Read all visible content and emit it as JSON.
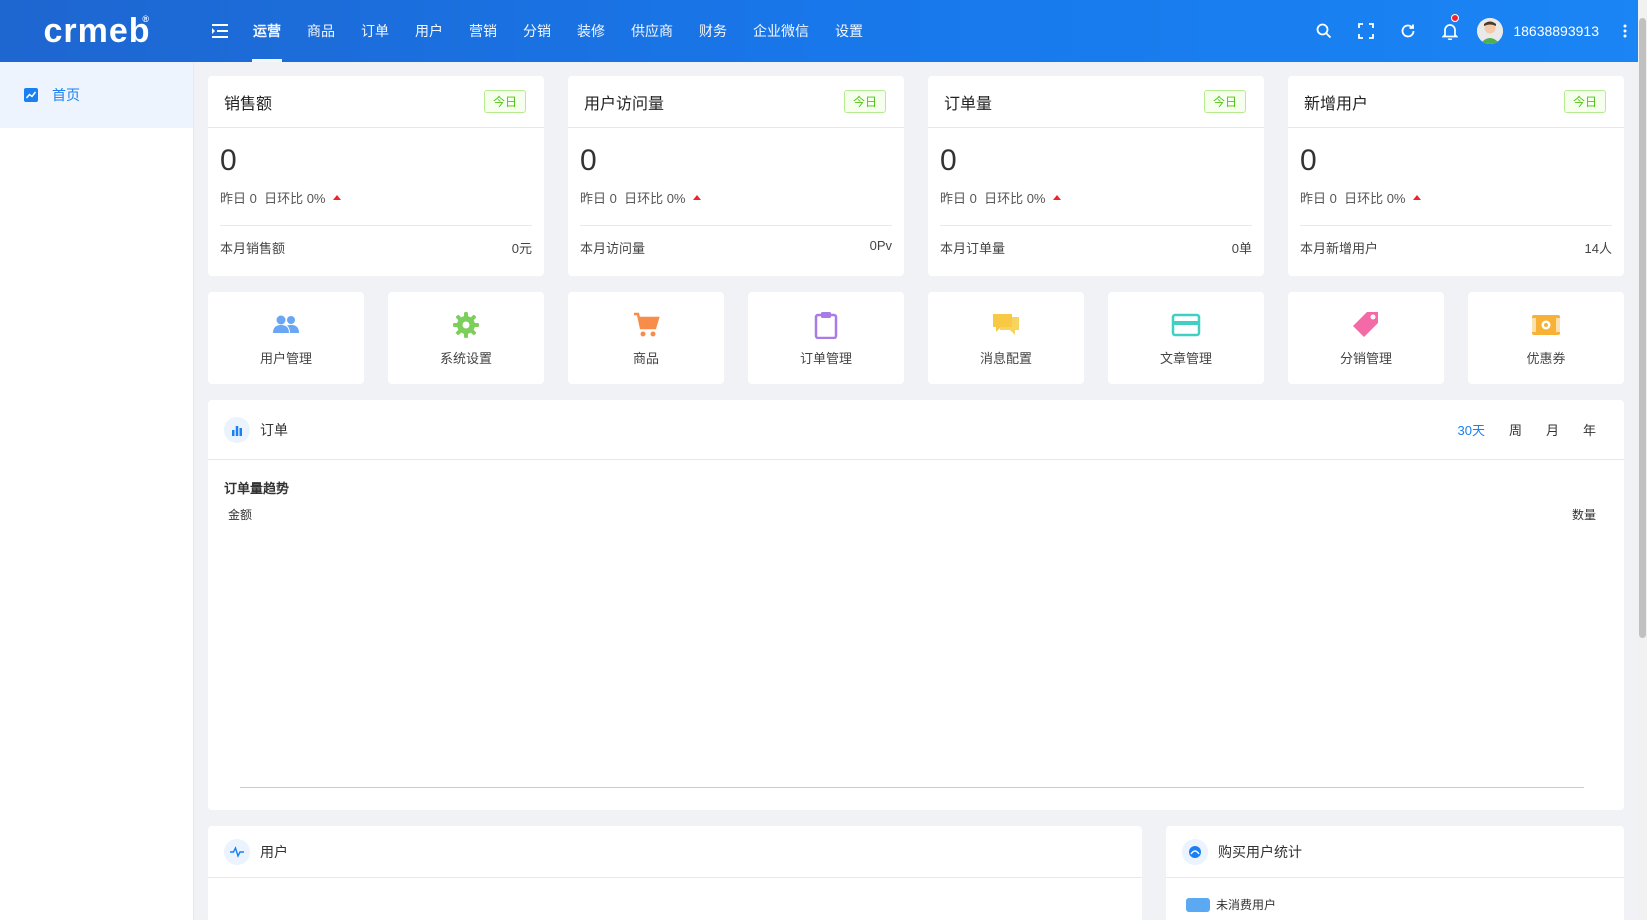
{
  "brand": {
    "logo_text": "crmeb",
    "reg_mark": "®"
  },
  "nav": {
    "items": [
      {
        "label": "运营",
        "active": true
      },
      {
        "label": "商品"
      },
      {
        "label": "订单"
      },
      {
        "label": "用户"
      },
      {
        "label": "营销"
      },
      {
        "label": "分销"
      },
      {
        "label": "装修"
      },
      {
        "label": "供应商"
      },
      {
        "label": "财务"
      },
      {
        "label": "企业微信"
      },
      {
        "label": "设置"
      }
    ]
  },
  "header": {
    "username": "18638893913"
  },
  "sidebar": {
    "items": [
      {
        "label": "首页",
        "active": true
      }
    ]
  },
  "stats": [
    {
      "title": "销售额",
      "tag": "今日",
      "value": "0",
      "yesterday": "昨日 0",
      "ratio": "日环比 0%",
      "foot_label": "本月销售额",
      "foot_value": "0元"
    },
    {
      "title": "用户访问量",
      "tag": "今日",
      "value": "0",
      "yesterday": "昨日 0",
      "ratio": "日环比 0%",
      "foot_label": "本月访问量",
      "foot_value": "0Pv"
    },
    {
      "title": "订单量",
      "tag": "今日",
      "value": "0",
      "yesterday": "昨日 0",
      "ratio": "日环比 0%",
      "foot_label": "本月订单量",
      "foot_value": "0单"
    },
    {
      "title": "新增用户",
      "tag": "今日",
      "value": "0",
      "yesterday": "昨日 0",
      "ratio": "日环比 0%",
      "foot_label": "本月新增用户",
      "foot_value": "14人"
    }
  ],
  "quick_links": [
    {
      "label": "用户管理",
      "icon": "users-icon",
      "color": "#69a7f5"
    },
    {
      "label": "系统设置",
      "icon": "gear-icon",
      "color": "#7ccf5a"
    },
    {
      "label": "商品",
      "icon": "cart-icon",
      "color": "#f88d4a"
    },
    {
      "label": "订单管理",
      "icon": "clipboard-icon",
      "color": "#a97be8"
    },
    {
      "label": "消息配置",
      "icon": "chat-icon",
      "color": "#f7c944"
    },
    {
      "label": "文章管理",
      "icon": "card-icon",
      "color": "#3fcfc3"
    },
    {
      "label": "分销管理",
      "icon": "tag-icon",
      "color": "#f36aa6"
    },
    {
      "label": "优惠券",
      "icon": "coupon-icon",
      "color": "#f7b136"
    }
  ],
  "order_panel": {
    "title": "订单",
    "ranges": [
      {
        "label": "30天",
        "active": true
      },
      {
        "label": "周"
      },
      {
        "label": "月"
      },
      {
        "label": "年"
      }
    ],
    "chart_title": "订单量趋势",
    "left_axis": "金额",
    "right_axis": "数量"
  },
  "user_panel": {
    "title": "用户"
  },
  "buyer_panel": {
    "title": "购买用户统计",
    "legend": "未消费用户"
  },
  "colors": {
    "primary": "#1a7ff0",
    "header_start": "#1e66d0",
    "header_end": "#1a85f5",
    "tag_green": "#52c41a",
    "up_red": "#f5222d"
  }
}
